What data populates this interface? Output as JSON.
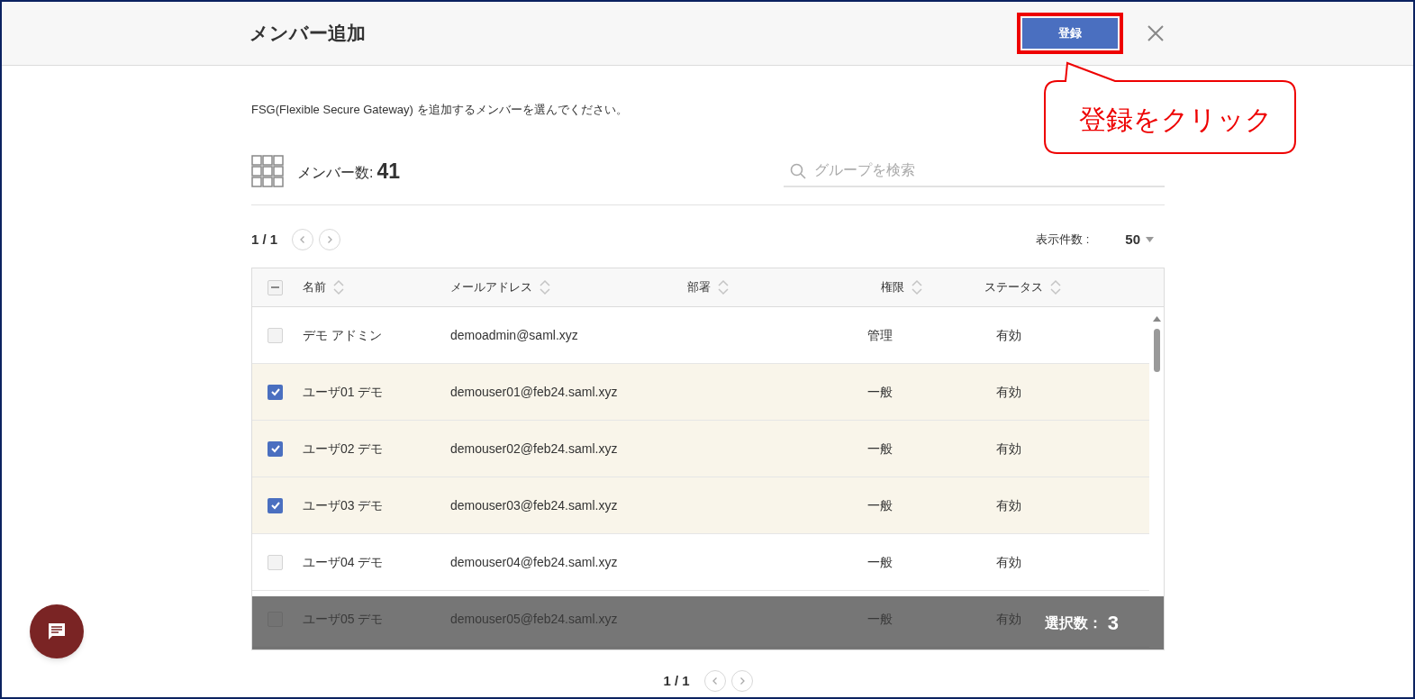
{
  "dialog": {
    "title": "メンバー追加",
    "register_button": "登録",
    "description": "FSG(Flexible Secure Gateway) を追加するメンバーを選んでください。",
    "member_count_label": "メンバー数:",
    "member_count": "41",
    "search": {
      "placeholder": "グループを検索"
    },
    "pager_top": "1 / 1",
    "page_size_label": "表示件数 :",
    "page_size": "50"
  },
  "table": {
    "select_all": {
      "indeterminate": true
    },
    "columns": [
      "名前",
      "メールアドレス",
      "部署",
      "権限",
      "ステータス"
    ],
    "rows": [
      {
        "name": "デモ アドミン",
        "email": "demoadmin@saml.xyz",
        "role": "管理",
        "status": "有効",
        "selected": false
      },
      {
        "name": "ユーザ01 デモ",
        "email": "demouser01@feb24.saml.xyz",
        "role": "一般",
        "status": "有効",
        "selected": true
      },
      {
        "name": "ユーザ02 デモ",
        "email": "demouser02@feb24.saml.xyz",
        "role": "一般",
        "status": "有効",
        "selected": true
      },
      {
        "name": "ユーザ03 デモ",
        "email": "demouser03@feb24.saml.xyz",
        "role": "一般",
        "status": "有効",
        "selected": true
      },
      {
        "name": "ユーザ04 デモ",
        "email": "demouser04@feb24.saml.xyz",
        "role": "一般",
        "status": "有効",
        "selected": false
      },
      {
        "name": "ユーザ05 デモ",
        "email": "demouser05@feb24.saml.xyz",
        "role": "一般",
        "status": "有効",
        "selected": false
      }
    ]
  },
  "selection_bar": {
    "label": "選択数：",
    "count": "3"
  },
  "pager_bottom": "1 / 1",
  "annotation": {
    "text": "登録をクリック"
  }
}
